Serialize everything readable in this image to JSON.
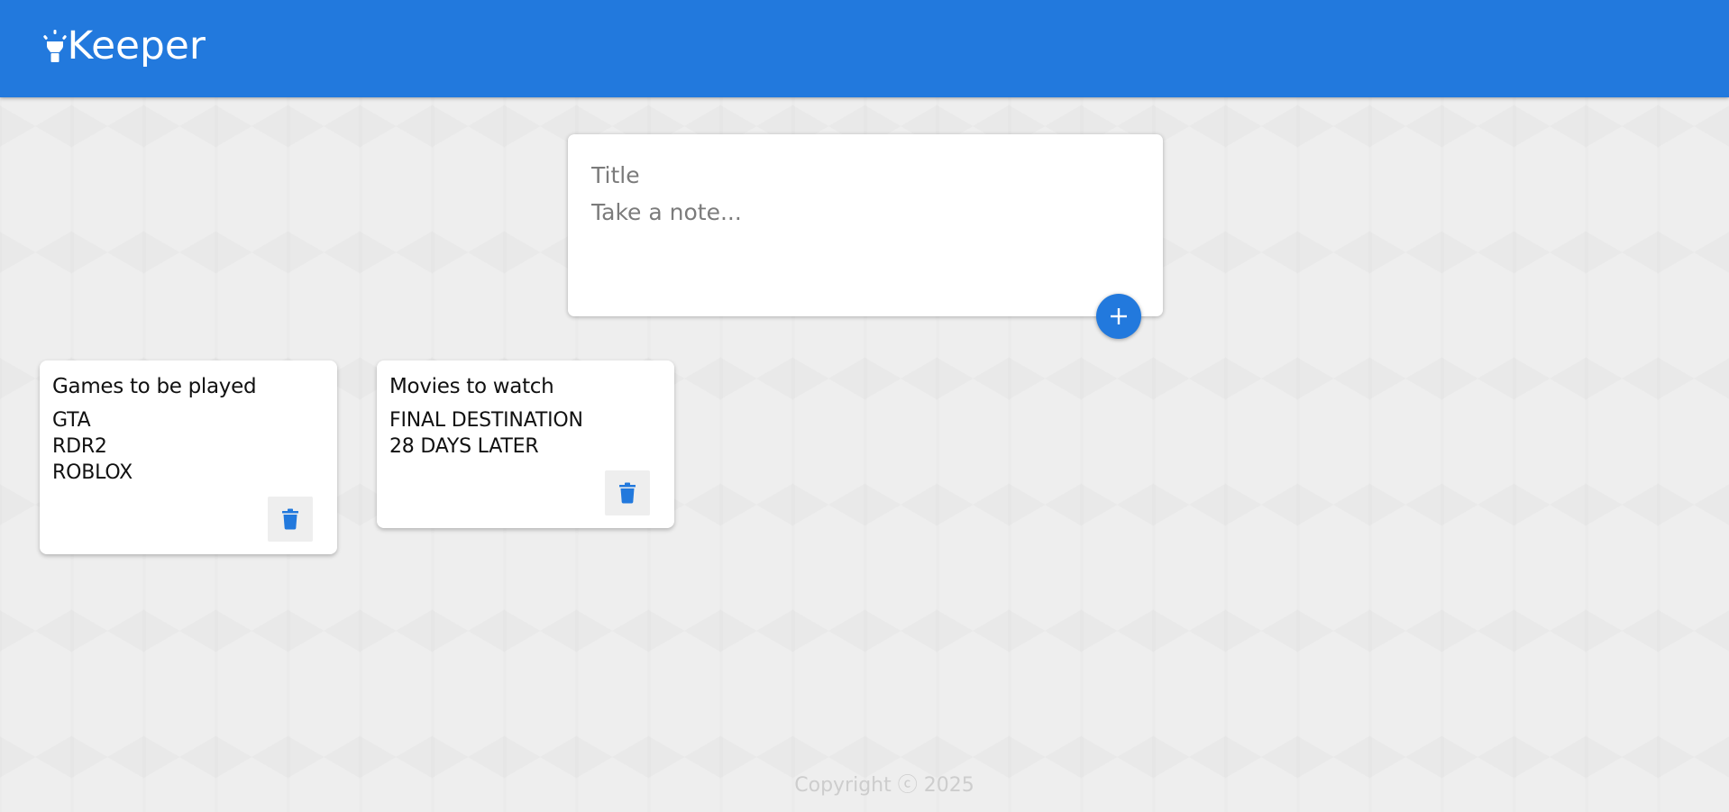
{
  "header": {
    "app_name": "Keeper",
    "icon": "lightbulb-icon",
    "color": "#2279dd"
  },
  "composer": {
    "title_placeholder": "Title",
    "note_placeholder": "Take a note...",
    "add_icon": "plus-icon"
  },
  "notes": [
    {
      "title": "Games to be played",
      "lines": [
        "GTA",
        "RDR2",
        "ROBLOX"
      ],
      "delete_icon": "trash-icon"
    },
    {
      "title": "Movies to watch",
      "lines": [
        "FINAL DESTINATION",
        "28 DAYS LATER"
      ],
      "delete_icon": "trash-icon"
    }
  ],
  "footer": {
    "text": "Copyright ⓒ 2025"
  }
}
